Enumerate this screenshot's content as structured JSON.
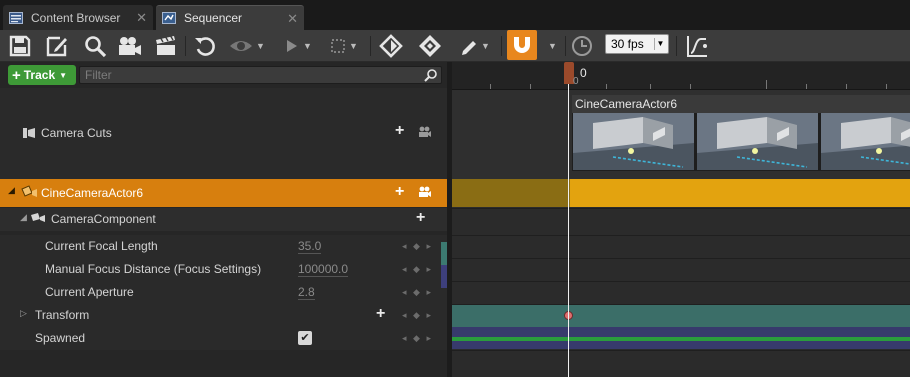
{
  "tabs": [
    {
      "label": "Content Browser",
      "close": "✕",
      "icon": "content-browser-icon"
    },
    {
      "label": "Sequencer",
      "close": "✕",
      "icon": "sequencer-icon"
    }
  ],
  "toolbar": {
    "fps_value": "30 fps",
    "icons": [
      "save-icon",
      "save-as-icon",
      "find-icon",
      "camera-icon",
      "render-movie-icon",
      "refresh-icon",
      "eye-icon",
      "play-icon",
      "selection-icon",
      "key-icon",
      "auto-key-icon",
      "edit-icon",
      "snap-icon",
      "time-icon",
      "curve-icon"
    ]
  },
  "outliner": {
    "add_track_label": "Track",
    "filter_placeholder": "Filter",
    "camera_cuts_label": "Camera Cuts",
    "actor_label": "CineCameraActor6",
    "component_label": "CameraComponent",
    "properties": [
      {
        "label": "Current Focal Length",
        "value": "35.0"
      },
      {
        "label": "Manual Focus Distance (Focus Settings)",
        "value": "100000.0"
      },
      {
        "label": "Current Aperture",
        "value": "2.8"
      }
    ],
    "transform_label": "Transform",
    "spawned_label": "Spawned",
    "spawned_checked": true,
    "key_nav": "◂ ◆ ▸"
  },
  "timeline": {
    "playhead_frame": "0",
    "playhead_zero": "0",
    "camera_section_label": "CineCameraActor6",
    "colors": {
      "actor_track": "#d77f0e",
      "transform_track": "#3b6e68",
      "spawned_track": "#373a6c",
      "spawned_bar": "#2a9b3d",
      "add_track_button": "#3e9a37"
    }
  }
}
